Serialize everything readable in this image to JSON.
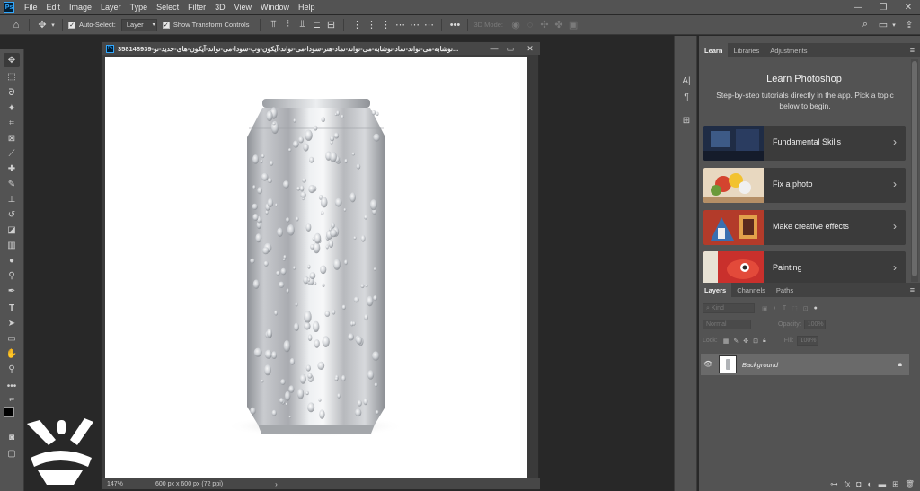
{
  "menubar": {
    "app_icon": "Ps",
    "items": [
      "File",
      "Edit",
      "Image",
      "Layer",
      "Type",
      "Select",
      "Filter",
      "3D",
      "View",
      "Window",
      "Help"
    ],
    "controls": {
      "minimize": "—",
      "restore": "❐",
      "close": "✕"
    }
  },
  "options": {
    "auto_select_label": "Auto-Select:",
    "auto_select_value": "Layer",
    "transform_label": "Show Transform Controls",
    "mode_3d_label": "3D Mode:"
  },
  "document": {
    "icon": "Ps",
    "title": "358148939-توشابه-می-تواند-نماد-نوشابه-می-تواند-نماد-هنر-سودا-می-تواند-آیکون-وب-سودا-می-تواند-آیکون-های-جدید-نو...",
    "zoom": "147%",
    "doc_info": "600 px x 600 px (72 ppi)"
  },
  "learn_panel": {
    "tabs": [
      "Learn",
      "Libraries",
      "Adjustments"
    ],
    "title": "Learn Photoshop",
    "subtitle": "Step-by-step tutorials directly in the app. Pick a topic below to begin.",
    "cards": [
      {
        "label": "Fundamental Skills"
      },
      {
        "label": "Fix a photo"
      },
      {
        "label": "Make creative effects"
      },
      {
        "label": "Painting"
      }
    ]
  },
  "layers_panel": {
    "tabs": [
      "Layers",
      "Channels",
      "Paths"
    ],
    "filter_placeholder": "Kind",
    "blend_mode": "Normal",
    "opacity_label": "Opacity:",
    "opacity_value": "100%",
    "lock_label": "Lock:",
    "fill_label": "Fill:",
    "fill_value": "100%",
    "layers": [
      {
        "name": "Background",
        "visible": true,
        "locked": true
      }
    ]
  },
  "colors": {
    "chrome": "#535353",
    "workspace": "#282828",
    "panel_dark": "#424242",
    "selected_layer": "#6a6a6a",
    "accent": "#31a8ff"
  }
}
